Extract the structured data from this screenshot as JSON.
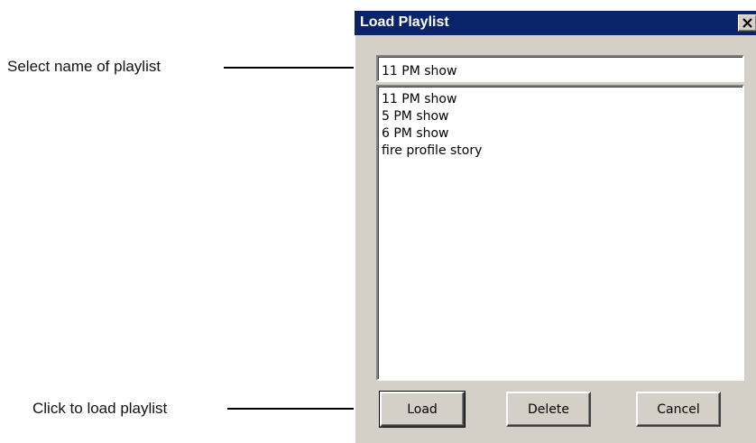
{
  "annotations": {
    "select_name": "Select name of playlist",
    "click_load": "Click to load playlist"
  },
  "dialog": {
    "title": "Load Playlist",
    "close_glyph": "×",
    "name_field": {
      "value": "11 PM show"
    },
    "playlists": [
      "11 PM show",
      "5 PM show",
      "6 PM show",
      "fire profile story"
    ],
    "buttons": {
      "load": "Load",
      "delete": "Delete",
      "cancel": "Cancel"
    }
  },
  "colors": {
    "titlebar": "#0a246a",
    "dialog_face": "#d4d0c8"
  }
}
